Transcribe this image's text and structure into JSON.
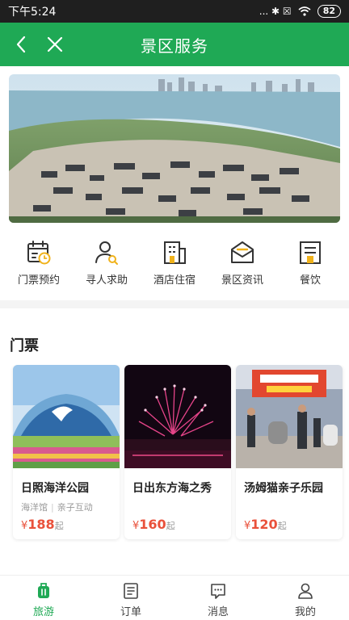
{
  "status_bar": {
    "time": "下午5:24",
    "indicators": "... ✱ ☒",
    "battery": "82"
  },
  "header": {
    "title": "景区服务",
    "back_icon": "chevron-left-icon",
    "close_icon": "close-icon"
  },
  "colors": {
    "primary": "#1fa955",
    "price": "#e9513b",
    "icon_outline": "#333333",
    "icon_accent": "#f0b21b"
  },
  "quick_nav": [
    {
      "label": "门票预约",
      "icon": "calendar-clock-icon"
    },
    {
      "label": "寻人求助",
      "icon": "person-search-icon"
    },
    {
      "label": "酒店住宿",
      "icon": "hotel-building-icon"
    },
    {
      "label": "景区资讯",
      "icon": "mail-envelope-icon"
    },
    {
      "label": "餐饮",
      "icon": "restaurant-building-icon"
    }
  ],
  "tickets": {
    "section_title": "门票",
    "items": [
      {
        "name": "日照海洋公园",
        "tags": [
          "海洋馆",
          "亲子互动"
        ],
        "currency": "¥",
        "price": "188",
        "suffix": "起"
      },
      {
        "name": "日出东方海之秀",
        "tags": [],
        "currency": "¥",
        "price": "160",
        "suffix": "起"
      },
      {
        "name": "汤姆猫亲子乐园",
        "tags": [],
        "currency": "¥",
        "price": "120",
        "suffix": "起"
      }
    ]
  },
  "tab_bar": [
    {
      "label": "旅游",
      "icon": "luggage-icon",
      "active": true
    },
    {
      "label": "订单",
      "icon": "order-list-icon",
      "active": false
    },
    {
      "label": "消息",
      "icon": "message-icon",
      "active": false
    },
    {
      "label": "我的",
      "icon": "user-icon",
      "active": false
    }
  ]
}
